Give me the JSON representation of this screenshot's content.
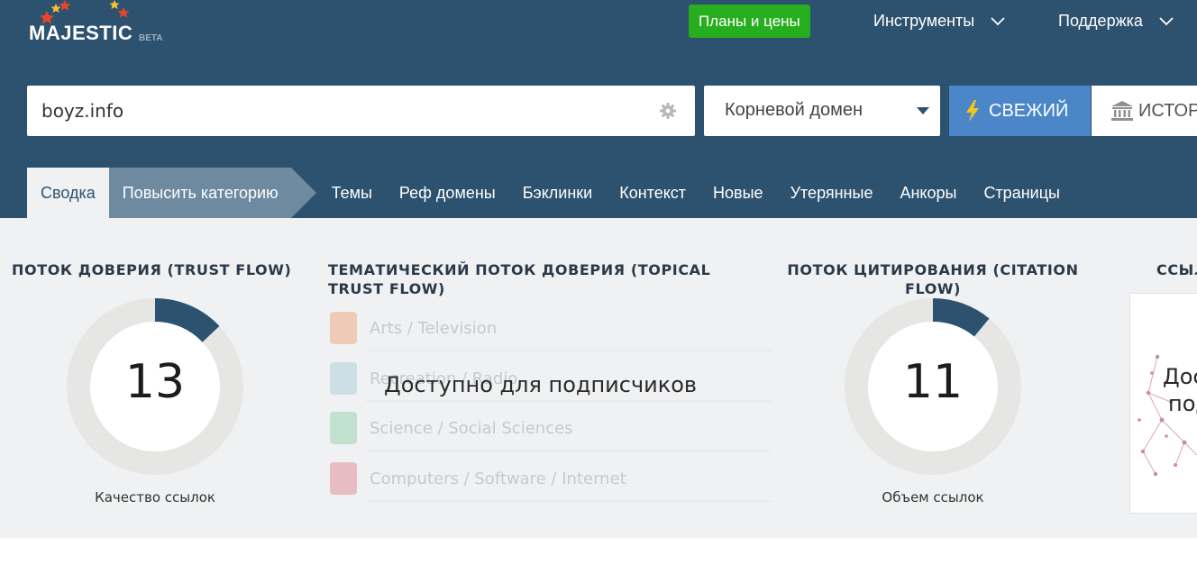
{
  "header": {
    "logo_text": "MAJESTIC",
    "logo_badge": "BETA",
    "plans_button": "Планы и цены",
    "nav": [
      {
        "label": "Инструменты"
      },
      {
        "label": "Поддержка"
      }
    ]
  },
  "search": {
    "query": "boyz.info",
    "scope_label": "Корневой домен",
    "fresh_button": "СВЕЖИЙ",
    "history_button": "ИСТОР"
  },
  "tabs": [
    {
      "label": "Сводка",
      "active": true
    },
    {
      "label": "Повысить категорию"
    },
    {
      "label": "Темы"
    },
    {
      "label": "Реф домены"
    },
    {
      "label": "Бэклинки"
    },
    {
      "label": "Контекст"
    },
    {
      "label": "Новые"
    },
    {
      "label": "Утерянные"
    },
    {
      "label": "Анкоры"
    },
    {
      "label": "Страницы"
    }
  ],
  "trust_flow": {
    "title": "ПОТОК ДОВЕРИЯ (TRUST FLOW)",
    "value": "13",
    "fraction": 0.13,
    "caption": "Качество ссылок"
  },
  "topical": {
    "title_line1": "ТЕМАТИЧЕСКИЙ ПОТОК ДОВЕРИЯ (TOPICAL",
    "title_line2": "TRUST FLOW)",
    "overlay": "Доступно для подписчиков",
    "topics": [
      {
        "label": "Arts / Television",
        "color": "#e8742a"
      },
      {
        "label": "Recreation / Radio",
        "color": "#7fb7c4"
      },
      {
        "label": "Science / Social Sciences",
        "color": "#55b87a"
      },
      {
        "label": "Computers / Software / Internet",
        "color": "#d8474e"
      }
    ]
  },
  "citation_flow": {
    "title_line1": "ПОТОК ЦИТИРОВАНИЯ (CITATION",
    "title_line2": "FLOW)",
    "value": "11",
    "fraction": 0.11,
    "caption": "Объем ссылок"
  },
  "link_profile": {
    "title": "ССЫЛ",
    "overlay_line1": "Дос",
    "overlay_line2": "под"
  },
  "colors": {
    "header_bg": "#2d526f",
    "donut_fill": "#2d526f",
    "donut_track": "#e6e6e4",
    "plans_green": "#27ae1e",
    "fresh_blue": "#4a86c8"
  }
}
